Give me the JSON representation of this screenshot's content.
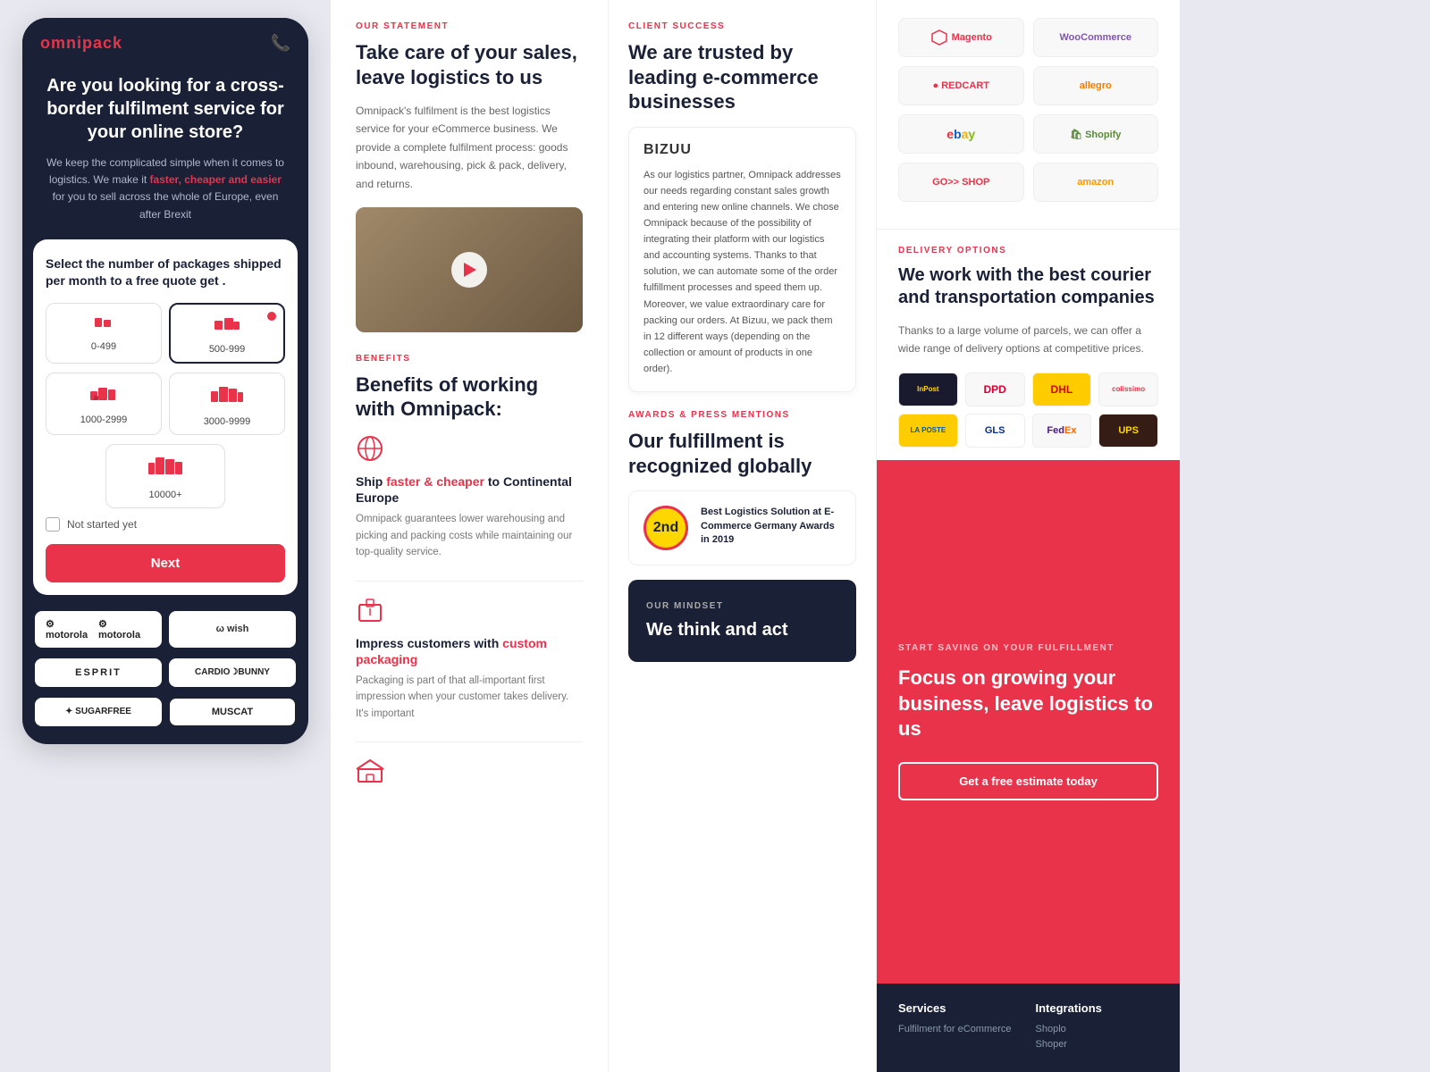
{
  "panel1": {
    "logo": "omnipack",
    "hero_title": "Are you looking for a cross-border fulfilment service for your online store?",
    "hero_sub_1": "We keep the complicated simple when it comes to logistics. We make it ",
    "hero_highlight": "faster, cheaper and easier",
    "hero_sub_2": " for you to sell across the whole of Europe, even after Brexit",
    "card_title": "Select the number of packages shipped per month to a free quote get .",
    "packages": [
      {
        "label": "0-499",
        "selected": false
      },
      {
        "label": "500-999",
        "selected": true
      },
      {
        "label": "1000-2999",
        "selected": false
      },
      {
        "label": "3000-9999",
        "selected": false
      },
      {
        "label": "10000+",
        "selected": false
      }
    ],
    "checkbox_label": "Not started yet",
    "next_btn": "Next",
    "brands": [
      "motorola",
      "wish",
      "ESPRIT",
      "CARDIO BUNNY",
      "SUGARFREE",
      "MUSCAT"
    ]
  },
  "panel2": {
    "statement_tag": "OUR STATEMENT",
    "statement_heading": "Take care of your sales, leave logistics to us",
    "statement_body": "Omnipack's fulfilment is the best logistics service for your eCommerce business. We provide a complete fulfilment process: goods inbound, warehousing, pick & pack, delivery, and returns.",
    "benefits_tag": "BENEFITS",
    "benefits_heading": "Benefits of working with Omnipack:",
    "benefit_items": [
      {
        "icon": "globe",
        "title_plain": "Ship ",
        "title_highlight": "faster & cheaper",
        "title_end": " to Continental Europe",
        "body": "Omnipack guarantees lower warehousing and picking and packing costs while maintaining our top-quality service."
      },
      {
        "icon": "box",
        "title_plain": "Impress customers with ",
        "title_highlight": "custom packaging",
        "title_end": "",
        "body": "Packaging is part of that all-important first impression when your customer takes delivery. It's important"
      },
      {
        "icon": "warehouse",
        "title_plain": "",
        "title_highlight": "",
        "title_end": "",
        "body": ""
      }
    ]
  },
  "panel3": {
    "client_tag": "CLIENT SUCCESS",
    "client_heading": "We are trusted by leading e-commerce businesses",
    "client_name": "BIZUU",
    "client_body": "As our logistics partner, Omnipack addresses our needs regarding constant sales growth and entering new online channels. We chose Omnipack because of the possibility of integrating their platform with our logistics and accounting systems. Thanks to that solution, we can automate some of the order fulfillment processes and speed them up. Moreover, we value extraordinary care for packing our orders. At Bizuu, we pack them in 12 different ways (depending on the collection or amount of products in one order).",
    "awards_tag": "AWARDS & PRESS MENTIONS",
    "awards_heading": "Our fulfillment is recognized globally",
    "award_badge_line1": "2nd",
    "award_title": "Best Logistics Solution at E-Commerce Germany Awards in 2019",
    "mindset_tag": "OUR MINDSET",
    "mindset_heading": "We think and act"
  },
  "panel4": {
    "ecom_logos": [
      "Magento",
      "WooCommerce",
      "REDCART",
      "allegro",
      "ebay",
      "Shopify",
      "GOSHOP",
      "amazon"
    ],
    "delivery_tag": "DELIVERY OPTIONS",
    "delivery_heading": "We work with the best courier and transportation companies",
    "delivery_body": "Thanks to a large volume of parcels, we can offer a wide range of delivery options at competitive prices.",
    "couriers": [
      "inpost",
      "DPD",
      "DHL",
      "colissimo",
      "LA POSTE",
      "GLS",
      "FedEx",
      "UPS"
    ],
    "cta_tag": "START SAVING ON YOUR FULFILLMENT",
    "cta_heading": "Focus on growing your business, leave logistics to us",
    "cta_btn": "Get a free estimate today",
    "footer": {
      "col1_title": "Services",
      "col1_items": [
        "Fulfilment for eCommerce"
      ],
      "col2_title": "Integrations",
      "col2_items": [
        "Shoplo",
        "Shoper"
      ]
    }
  }
}
